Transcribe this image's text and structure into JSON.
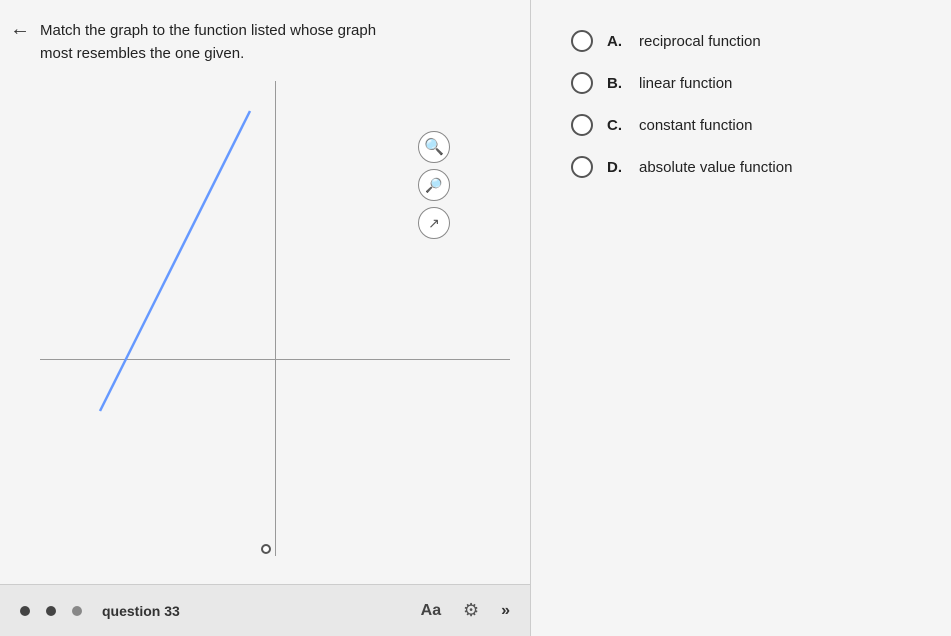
{
  "back_arrow": "←",
  "question": {
    "text_line1": "Match the graph to the function listed whose graph",
    "text_line2": "most resembles the one given."
  },
  "tools": {
    "zoom_in": "🔍",
    "zoom_out": "🔍",
    "expand": "⤢"
  },
  "options": [
    {
      "id": "A",
      "label": "A.",
      "text": "reciprocal function"
    },
    {
      "id": "B",
      "label": "B.",
      "text": "linear function"
    },
    {
      "id": "C",
      "label": "C.",
      "text": "constant function"
    },
    {
      "id": "D",
      "label": "D.",
      "text": "absolute value function"
    }
  ],
  "bottom_bar": {
    "question_label": "question 33",
    "font_btn": "Aa",
    "chevron": "»"
  },
  "colors": {
    "line_color": "#6699ff",
    "axis_color": "#999999"
  }
}
